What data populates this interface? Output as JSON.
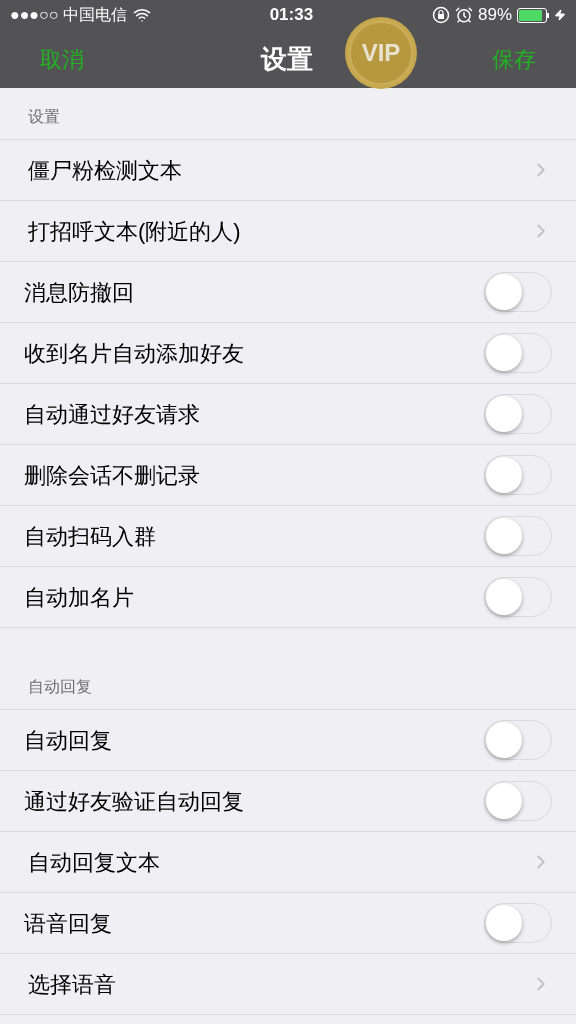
{
  "status_bar": {
    "carrier": "●●●○○ 中国电信",
    "time": "01:33",
    "battery": "89%"
  },
  "nav": {
    "cancel": "取消",
    "title": "设置",
    "badge": "VIP",
    "save": "保存"
  },
  "sections": [
    {
      "header": "设置",
      "rows": [
        {
          "kind": "link",
          "label": "僵尸粉检测文本"
        },
        {
          "kind": "link",
          "label": "打招呼文本(附近的人)"
        },
        {
          "kind": "toggle",
          "label": "消息防撤回",
          "on": false
        },
        {
          "kind": "toggle",
          "label": "收到名片自动添加好友",
          "on": false
        },
        {
          "kind": "toggle",
          "label": "自动通过好友请求",
          "on": false
        },
        {
          "kind": "toggle",
          "label": "删除会话不删记录",
          "on": false
        },
        {
          "kind": "toggle",
          "label": "自动扫码入群",
          "on": false
        },
        {
          "kind": "toggle",
          "label": "自动加名片",
          "on": false
        }
      ]
    },
    {
      "header": "自动回复",
      "rows": [
        {
          "kind": "toggle",
          "label": "自动回复",
          "on": false
        },
        {
          "kind": "toggle",
          "label": "通过好友验证自动回复",
          "on": false
        },
        {
          "kind": "link",
          "label": "自动回复文本"
        },
        {
          "kind": "toggle",
          "label": "语音回复",
          "on": false
        },
        {
          "kind": "link",
          "label": "选择语音"
        }
      ]
    }
  ]
}
